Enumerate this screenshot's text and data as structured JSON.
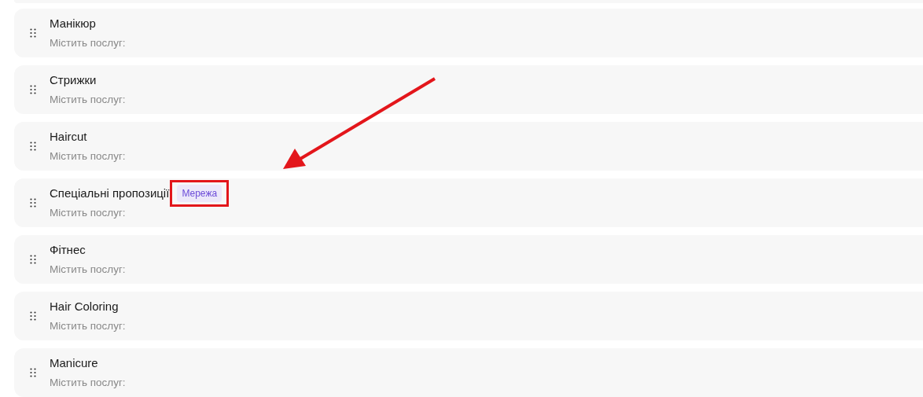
{
  "categories": [
    {
      "title": "Манікюр",
      "subtitle": "Містить послуг:"
    },
    {
      "title": "Стрижки",
      "subtitle": "Містить послуг:"
    },
    {
      "title": "Haircut",
      "subtitle": "Містить послуг:"
    },
    {
      "title": "Спеціальні пропозиції",
      "subtitle": "Містить послуг:",
      "badge": "Мережа",
      "highlighted": true
    },
    {
      "title": "Фітнес",
      "subtitle": "Містить послуг:"
    },
    {
      "title": "Hair Coloring",
      "subtitle": "Містить послуг:"
    },
    {
      "title": "Manicure",
      "subtitle": "Містить послуг:"
    }
  ],
  "annotation": {
    "arrow": true
  }
}
